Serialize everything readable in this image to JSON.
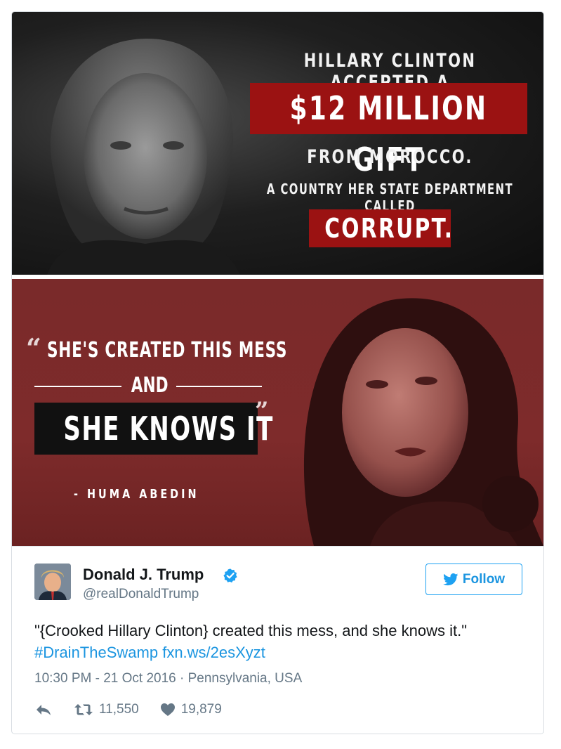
{
  "top_image": {
    "line1": "HILLARY CLINTON ACCEPTED A",
    "highlight": "$12 MILLION GIFT",
    "line3": "FROM MOROCCO.",
    "line4": "A COUNTRY HER STATE DEPARTMENT CALLED",
    "highlight2": "CORRUPT."
  },
  "bottom_image": {
    "quote_line1": "SHE'S CREATED THIS MESS",
    "quote_and": "AND",
    "quote_box": "SHE KNOWS IT",
    "attribution": "- HUMA ABEDIN"
  },
  "tweet": {
    "author_name": "Donald J. Trump",
    "author_handle": "@realDonaldTrump",
    "follow_label": "Follow",
    "text": "\"{Crooked Hillary Clinton} created this mess, and she knows it.\"",
    "hashtag": "#DrainTheSwamp",
    "link": "fxn.ws/2esXyzt",
    "timestamp": "10:30 PM - 21 Oct 2016 · Pennsylvania, USA",
    "retweets": "11,550",
    "likes": "19,879"
  },
  "colors": {
    "accent": "#1da1f2",
    "link": "#1b95e0",
    "banner_red": "#9b1212",
    "panel_red": "#7a2a2a",
    "muted": "#657786"
  },
  "icons": [
    "verified-icon",
    "twitter-bird-icon",
    "reply-icon",
    "retweet-icon",
    "heart-icon"
  ]
}
